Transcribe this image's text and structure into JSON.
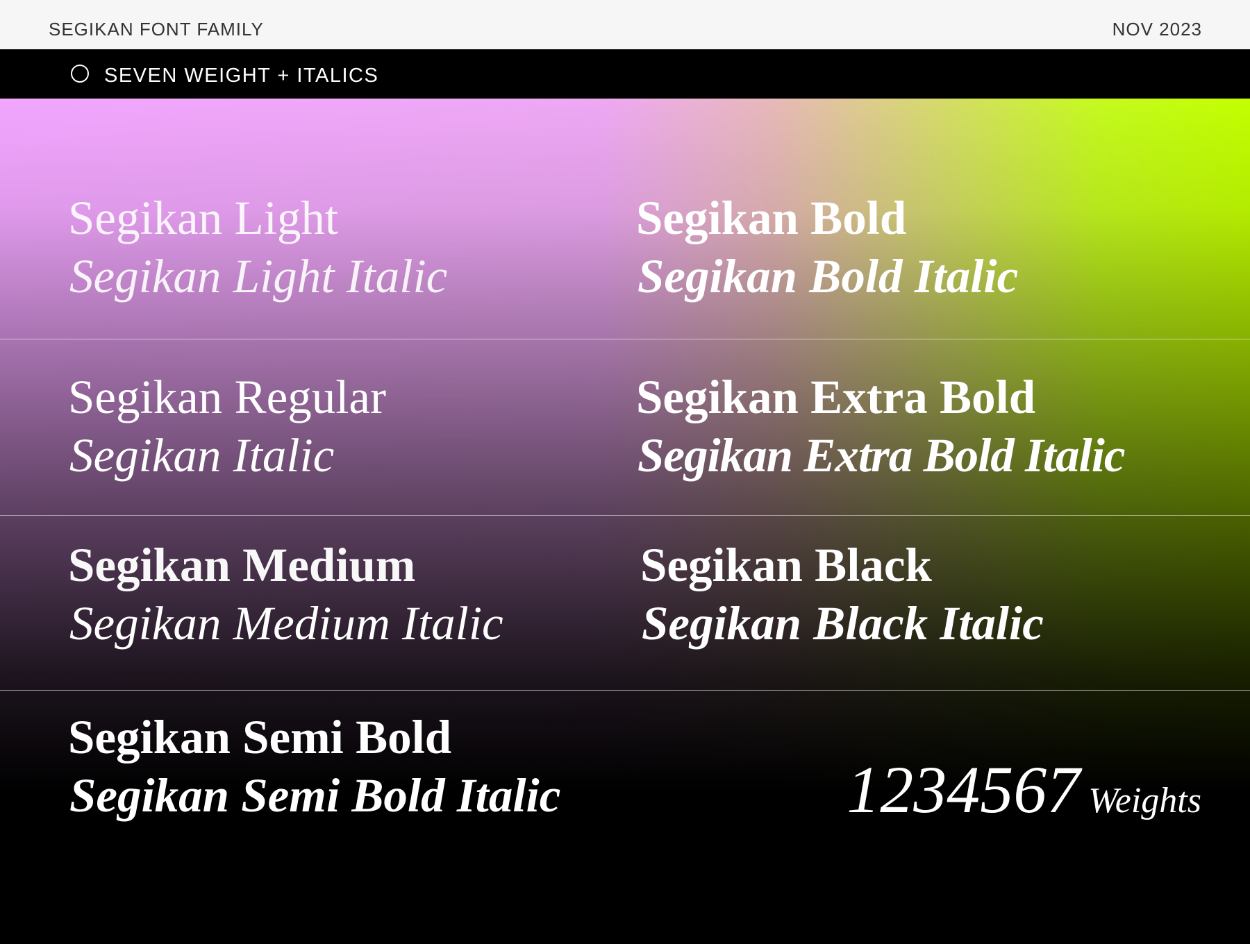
{
  "header": {
    "title": "SEGIKAN FONT FAMILY",
    "date": "NOV 2023"
  },
  "subheader": {
    "icon": "circle-outline-icon",
    "label": "SEVEN WEIGHT + ITALICS"
  },
  "colors": {
    "gradient_left": "#f2a6ff",
    "gradient_right": "#c3ff00",
    "background": "#000000",
    "header_bg": "#f7f6f7"
  },
  "weights": {
    "light": "Segikan Light",
    "light_italic": "Segikan Light Italic",
    "bold": "Segikan Bold",
    "bold_italic": "Segikan Bold Italic",
    "regular": "Segikan Regular",
    "italic": "Segikan Italic",
    "extra_bold": "Segikan Extra Bold",
    "extra_bold_italic": "Segikan Extra Bold Italic",
    "medium": "Segikan Medium",
    "medium_italic": "Segikan Medium Italic",
    "black": "Segikan Black",
    "black_italic": "Segikan Black Italic",
    "semi_bold": "Segikan Semi Bold",
    "semi_bold_italic": "Segikan Semi Bold Italic"
  },
  "summary": {
    "digits": "1234567",
    "word": "Weights"
  }
}
